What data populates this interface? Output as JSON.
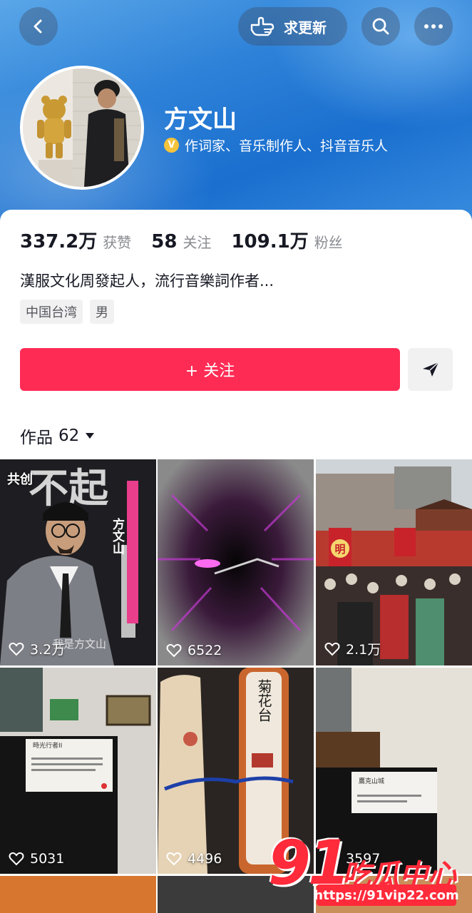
{
  "top_bar": {
    "refresh_label": "求更新",
    "icons": [
      "back-icon",
      "hand-point-icon",
      "search-icon",
      "more-icon"
    ]
  },
  "profile": {
    "name": "方文山",
    "verified_text": "作词家、音乐制作人、抖音音乐人",
    "stats": {
      "likes_value": "337.2万",
      "likes_label": "获赞",
      "following_value": "58",
      "following_label": "关注",
      "followers_value": "109.1万",
      "followers_label": "粉丝"
    },
    "bio": "漢服文化周發起人，流行音樂詞作者...",
    "tags": [
      "中国台湾",
      "男"
    ]
  },
  "actions": {
    "follow_label": "+ 关注"
  },
  "works": {
    "tab_label": "作品",
    "count": "62"
  },
  "videos": [
    {
      "likes": "3.2万",
      "badge": "共创",
      "overlay_name": "方文山",
      "overlay_sub": "我是方文山"
    },
    {
      "likes": "6522"
    },
    {
      "likes": "2.1万",
      "sign": "明"
    },
    {
      "likes": "5031",
      "card_title": "時光行者II"
    },
    {
      "likes": "4496",
      "scroll_text": "菊花台"
    },
    {
      "likes": "3597",
      "card_title": "鷹克山城"
    }
  ],
  "watermark": {
    "brand_number": "91",
    "brand_text": "吃瓜中心",
    "url": "https://91vip22.com"
  },
  "colors": {
    "accent": "#fe2c55",
    "header_blue": "#2e82d8",
    "verified_gold": "#f5c33b"
  }
}
